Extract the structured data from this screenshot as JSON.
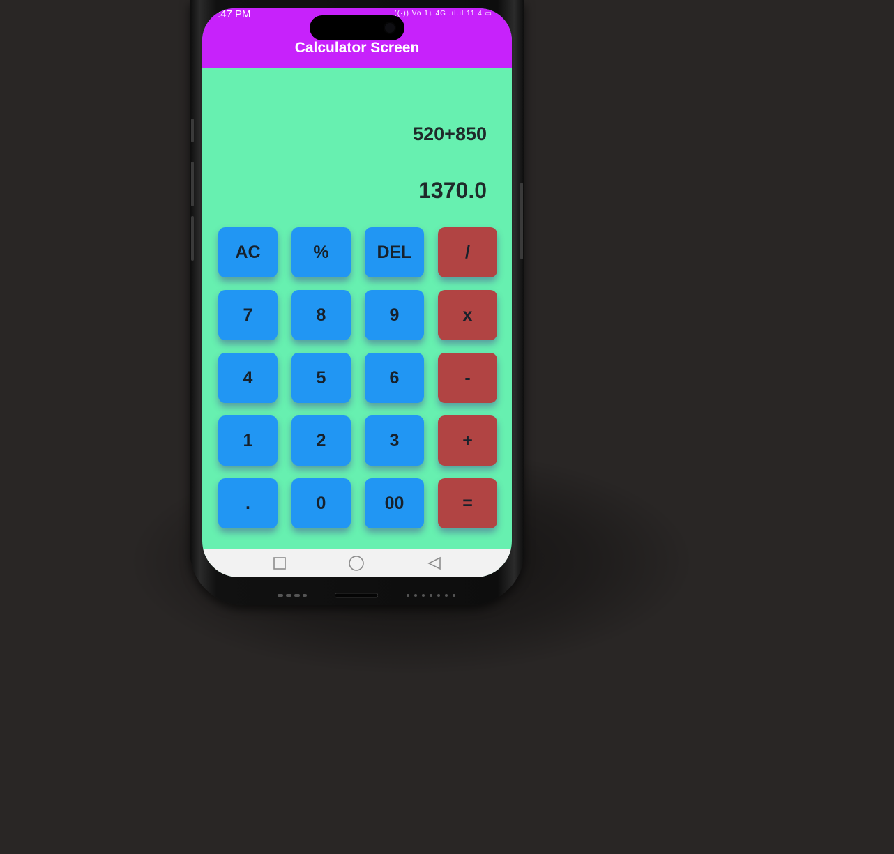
{
  "status_bar": {
    "time": ":47 PM",
    "icons_text": "((·)) Vo 1↓ 4G .ıl.ıl 11.4 ▭"
  },
  "app_bar": {
    "title": "Calculator Screen"
  },
  "display": {
    "expression": "520+850",
    "result": "1370.0"
  },
  "keypad": {
    "rows": [
      [
        {
          "label": "AC",
          "kind": "num"
        },
        {
          "label": "%",
          "kind": "num"
        },
        {
          "label": "DEL",
          "kind": "num"
        },
        {
          "label": "/",
          "kind": "op"
        }
      ],
      [
        {
          "label": "7",
          "kind": "num"
        },
        {
          "label": "8",
          "kind": "num"
        },
        {
          "label": "9",
          "kind": "num"
        },
        {
          "label": "x",
          "kind": "op"
        }
      ],
      [
        {
          "label": "4",
          "kind": "num"
        },
        {
          "label": "5",
          "kind": "num"
        },
        {
          "label": "6",
          "kind": "num"
        },
        {
          "label": "-",
          "kind": "op"
        }
      ],
      [
        {
          "label": "1",
          "kind": "num"
        },
        {
          "label": "2",
          "kind": "num"
        },
        {
          "label": "3",
          "kind": "num"
        },
        {
          "label": "+",
          "kind": "op"
        }
      ],
      [
        {
          "label": ".",
          "kind": "num"
        },
        {
          "label": "0",
          "kind": "num"
        },
        {
          "label": "00",
          "kind": "num"
        },
        {
          "label": "=",
          "kind": "op"
        }
      ]
    ]
  },
  "navigation_bar": {
    "buttons": [
      "recents-square-icon",
      "home-circle-icon",
      "back-triangle-icon"
    ]
  },
  "colors": {
    "app_bar": "#c722fb",
    "background": "#67f0b0",
    "number_key": "#2196f3",
    "operator_key": "#b14443",
    "divider": "#c65a5a"
  }
}
